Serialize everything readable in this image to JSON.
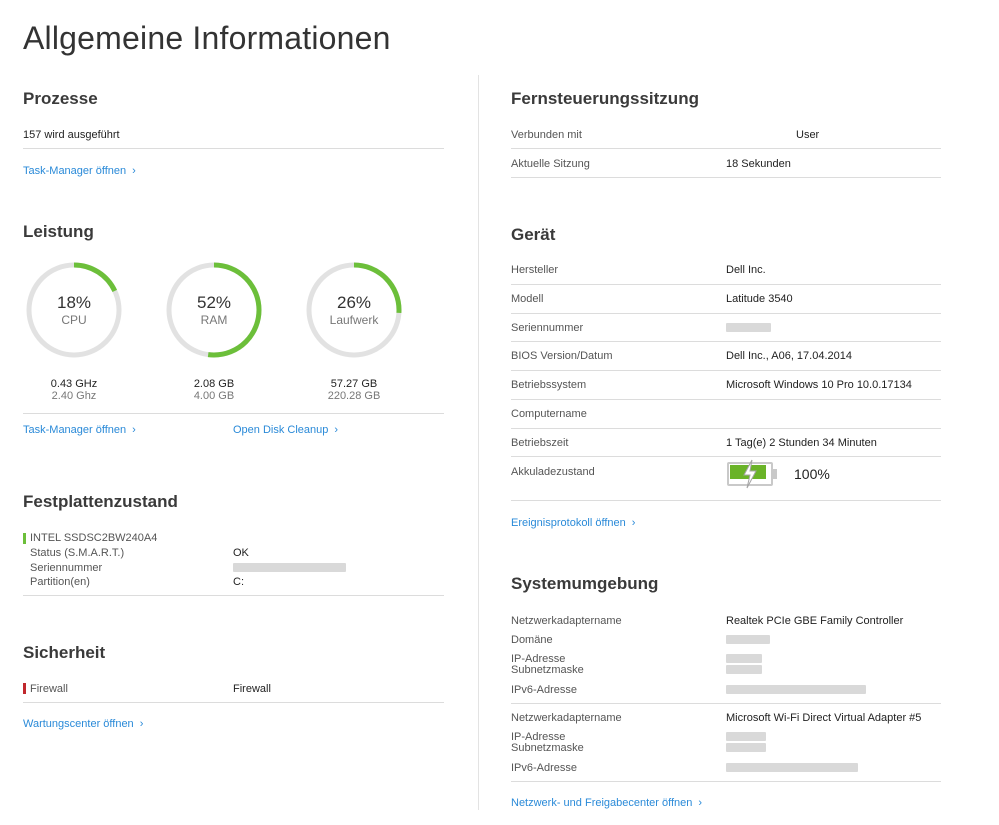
{
  "page": {
    "title": "Allgemeine Informationen"
  },
  "processes": {
    "title": "Prozesse",
    "running": "157 wird ausgeführt",
    "link": "Task-Manager öffnen"
  },
  "performance": {
    "title": "Leistung",
    "gauges": [
      {
        "pct_label": "18%",
        "name": "CPU",
        "fraction": 0.18,
        "value": "0.43 GHz",
        "max": "2.40 Ghz"
      },
      {
        "pct_label": "52%",
        "name": "RAM",
        "fraction": 0.52,
        "value": "2.08 GB",
        "max": "4.00 GB"
      },
      {
        "pct_label": "26%",
        "name": "Laufwerk",
        "fraction": 0.26,
        "value": "57.27 GB",
        "max": "220.28 GB"
      }
    ],
    "link_task_manager": "Task-Manager öffnen",
    "link_disk_cleanup": "Open Disk Cleanup",
    "gauge_color": "#6cbf3a",
    "gauge_track": "#e2e2e2"
  },
  "disk": {
    "title": "Festplattenzustand",
    "drive": "INTEL SSDSC2BW240A4",
    "status_label": "Status (S.M.A.R.T.)",
    "status_value": "OK",
    "serial_label": "Seriennummer",
    "partition_label": "Partition(en)",
    "partition_value": "C:"
  },
  "security": {
    "title": "Sicherheit",
    "firewall_label": "Firewall",
    "firewall_value": "Firewall",
    "link": "Wartungscenter öffnen"
  },
  "remote": {
    "title": "Fernsteuerungssitzung",
    "connected_label": "Verbunden mit",
    "connected_value": "User",
    "session_label": "Aktuelle Sitzung",
    "session_value": "18 Sekunden"
  },
  "device": {
    "title": "Gerät",
    "rows": [
      {
        "label": "Hersteller",
        "value": "Dell Inc."
      },
      {
        "label": "Modell",
        "value": "Latitude 3540"
      },
      {
        "label": "Seriennummer",
        "value": ""
      },
      {
        "label": "BIOS Version/Datum",
        "value": "Dell Inc., A06, 17.04.2014"
      },
      {
        "label": "Betriebssystem",
        "value": "Microsoft Windows 10 Pro 10.0.17134"
      },
      {
        "label": "Computername",
        "value": ""
      },
      {
        "label": "Betriebszeit",
        "value": "1 Tag(e) 2 Stunden 34 Minuten"
      }
    ],
    "battery_label": "Akkuladezustand",
    "battery_value": "100%",
    "battery_fraction": 1.0,
    "link": "Ereignisprotokoll öffnen"
  },
  "network": {
    "title": "Systemumgebung",
    "adapter_label": "Netzwerkadaptername",
    "adapter1": "Realtek PCIe GBE Family Controller",
    "domain_label": "Domäne",
    "ip_label": "IP-Adresse",
    "subnet_label": "Subnetzmaske",
    "ipv6_label": "IPv6-Adresse",
    "adapter2": "Microsoft Wi-Fi Direct Virtual Adapter #5",
    "link": "Netzwerk- und Freigabecenter öffnen"
  },
  "colors": {
    "accent_link": "#2a8ad8",
    "ok_green": "#6cbf3a",
    "alert_red": "#c0282d"
  }
}
